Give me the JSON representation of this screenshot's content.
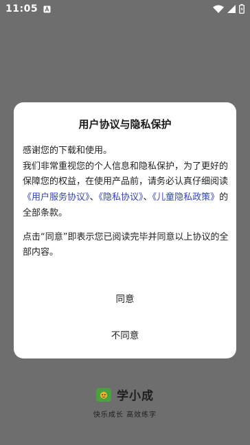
{
  "status_bar": {
    "time": "11:05",
    "notification_icon": "a-app-icon",
    "wifi_icon": "wifi-icon",
    "signal_icon": "signal-icon",
    "battery_icon": "battery-icon"
  },
  "dialog": {
    "title": "用户协议与隐私保护",
    "para1": "感谢您的下载和使用。",
    "para2_lead": "我们非常重视您的个人信息和隐私保护，为了更好的保障您的权益，在使用产品前，请务必认真仔细阅读",
    "link_user_service": "《用户服务协议》",
    "separator1": "、",
    "link_privacy": "《隐私协议》",
    "separator2": "、",
    "link_child_privacy": "《儿童隐私政策》",
    "para2_tail": "的全部条款。",
    "para3": "点击“同意”即表示您已阅读完毕并同意以上协议的全部内容。",
    "agree_label": "同意",
    "disagree_label": "不同意",
    "link_color": "#3445b8"
  },
  "brand": {
    "name": "学小成",
    "slogan": "快乐成长 高效练字",
    "logo_color": "#4aa13d"
  }
}
